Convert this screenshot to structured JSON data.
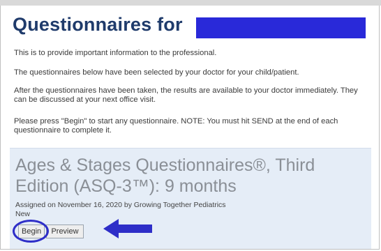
{
  "page": {
    "title": "Questionnaires for",
    "info": [
      "This is to provide important information to the professional.",
      "The questionnaires below have been selected by your doctor for your child/patient.",
      "After the questionnaires have been taken, the results are available to your doctor immediately. They can be discussed at your next office visit.",
      "Please press \"Begin\" to start any questionnaire. NOTE: You must hit SEND at the end of each questionnaire to complete it."
    ]
  },
  "questionnaire": {
    "title": "Ages & Stages Questionnaires®, Third Edition (ASQ-3™): 9 months",
    "assigned": "Assigned on November 16, 2020 by Growing Together Pediatrics",
    "status": "New",
    "begin_label": "Begin",
    "preview_label": "Preview"
  },
  "colors": {
    "title": "#1f3b6b",
    "redaction": "#2929d9",
    "card_bg": "#e5edf7",
    "annotation": "#2e2ec8"
  }
}
